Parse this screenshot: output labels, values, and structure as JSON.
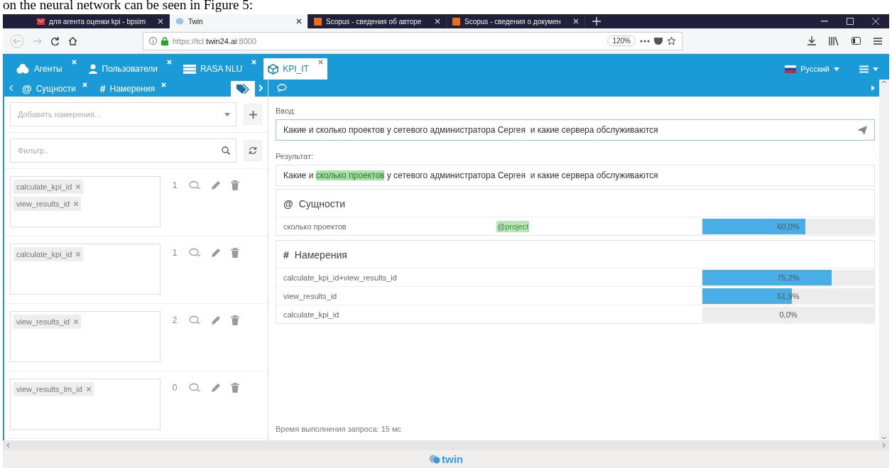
{
  "caption": "on the neural network can be seen in Figure 5:",
  "browser": {
    "tabs": [
      {
        "title": "для агента оценки kpi - bpsim",
        "selected": false
      },
      {
        "title": "Twin",
        "selected": true
      },
      {
        "title": "Scopus - сведения об авторе",
        "selected": false
      },
      {
        "title": "Scopus - сведения о докумен",
        "selected": false
      }
    ],
    "url": "https://tcl.**twin24.ai**:8000",
    "zoom": "120%"
  },
  "app_tabs": [
    {
      "label": "Агенты",
      "selected": false
    },
    {
      "label": "Пользователи",
      "selected": false
    },
    {
      "label": "RASA NLU",
      "selected": false
    },
    {
      "label": "KPI_IT",
      "selected": true
    }
  ],
  "language": "Русский",
  "sub_tabs": [
    {
      "kind": "text",
      "icon": "@",
      "label": "Сущности",
      "selected": false
    },
    {
      "kind": "text",
      "icon": "#",
      "label": "Намерения",
      "selected": false
    },
    {
      "kind": "tag",
      "selected": true
    }
  ],
  "left": {
    "add_placeholder": "Добавить намерения...",
    "filter_placeholder": "Фильтр..",
    "groups": [
      {
        "tags": [
          "calculate_kpi_id",
          "view_results_id"
        ],
        "count": "1"
      },
      {
        "tags": [
          "calculate_kpi_id"
        ],
        "count": "1"
      },
      {
        "tags": [
          "view_results_id"
        ],
        "count": "2"
      },
      {
        "tags": [
          "view_results_lm_id"
        ],
        "count": "0"
      }
    ]
  },
  "right": {
    "input_label": "Ввод:",
    "input_value": "Какие и сколько проектов у сетевого администратора Сергея  и какие сервера обслуживаются",
    "result_label": "Результат:",
    "result_parts": [
      {
        "text": "Какие и ",
        "highlight": false
      },
      {
        "text": "сколько проектов",
        "highlight": true
      },
      {
        "text": " у сетевого администратора Сергея  и какие сервера обслуживаются",
        "highlight": false
      }
    ],
    "entities": {
      "icon": "@",
      "title": "Сущности",
      "rows": [
        {
          "text": "сколько проектов",
          "entity": "@project",
          "level": 0.6,
          "reading": "60,0%"
        }
      ]
    },
    "intents": {
      "icon": "#",
      "title": "Намерения",
      "rows": [
        {
          "text": "calculate_kpi_id+view_results_id",
          "level": 0.752,
          "reading": "75,2%"
        },
        {
          "text": "view_results_id",
          "level": 0.519,
          "reading": "51,9%"
        },
        {
          "text": "calculate_kpi_id",
          "reading": "0,0%"
        }
      ]
    },
    "timing": "Время выполнения запроса: 15 мс"
  },
  "footer_logo": "twin"
}
